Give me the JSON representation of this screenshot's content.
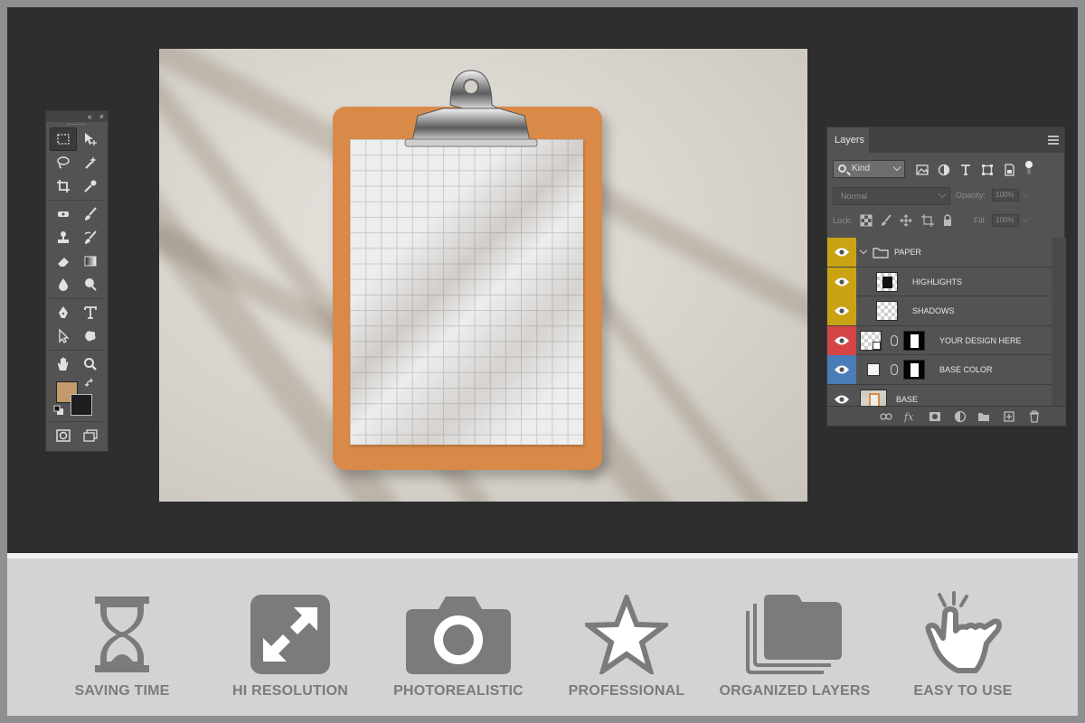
{
  "tools_panel": {
    "collapse_label": "«",
    "close_label": "×",
    "rows": [
      [
        "marquee-icon",
        "move-icon"
      ],
      [
        "lasso-icon",
        "magic-wand-icon"
      ],
      [
        "crop-icon",
        "eyedropper-icon"
      ],
      [
        "healing-brush-icon",
        "brush-icon"
      ],
      [
        "clone-stamp-icon",
        "history-brush-icon"
      ],
      [
        "eraser-icon",
        "gradient-icon"
      ],
      [
        "blur-icon",
        "dodge-icon"
      ],
      [
        "pen-icon",
        "type-icon"
      ],
      [
        "path-selection-icon",
        "shape-icon"
      ],
      [
        "hand-icon",
        "zoom-icon"
      ]
    ],
    "foreground_color": "#c49a6c",
    "background_color": "#1e1e1e"
  },
  "layers_panel": {
    "tab_label": "Layers",
    "filter": {
      "value": "Kind"
    },
    "blend_mode": "Normal",
    "opacity_label": "Opacity:",
    "opacity_value": "100%",
    "lock_label": "Lock:",
    "fill_label": "Fill:",
    "fill_value": "100%",
    "layers": [
      {
        "name": "PAPER",
        "type": "group",
        "color": "#c9a314"
      },
      {
        "name": "HIGHLIGHTS",
        "type": "layer",
        "color": "#c9a314"
      },
      {
        "name": "SHADOWS",
        "type": "layer",
        "color": "#c9a314"
      },
      {
        "name": "YOUR DESIGN HERE",
        "type": "smart",
        "color": "#d64545"
      },
      {
        "name": "BASE COLOR",
        "type": "fill",
        "color": "#4a7db8"
      },
      {
        "name": "BASE",
        "type": "image",
        "color": "#535353"
      }
    ]
  },
  "features": [
    {
      "label": "SAVING TIME",
      "icon": "hourglass-icon"
    },
    {
      "label": "HI RESOLUTION",
      "icon": "resize-icon"
    },
    {
      "label": "PHOTOREALISTIC",
      "icon": "camera-icon"
    },
    {
      "label": "PROFESSIONAL",
      "icon": "star-icon"
    },
    {
      "label": "ORGANIZED LAYERS",
      "icon": "layers-folder-icon"
    },
    {
      "label": "EASY TO USE",
      "icon": "tap-hand-icon"
    }
  ],
  "colors": {
    "workspace": "#2e2e2e",
    "panel": "#535353",
    "clipboard": "#d98a48",
    "feature_icon": "#7b7b7b"
  }
}
